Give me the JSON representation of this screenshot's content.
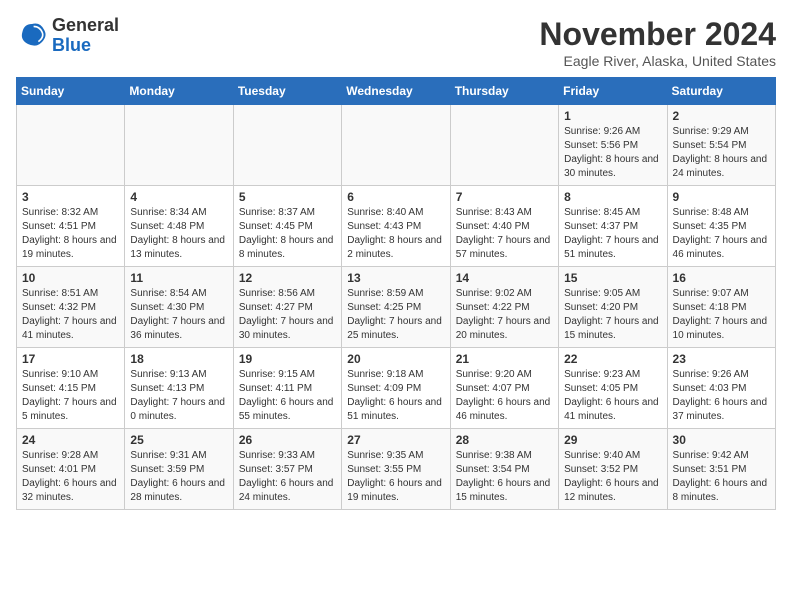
{
  "header": {
    "logo_general": "General",
    "logo_blue": "Blue",
    "month_title": "November 2024",
    "location": "Eagle River, Alaska, United States"
  },
  "days_of_week": [
    "Sunday",
    "Monday",
    "Tuesday",
    "Wednesday",
    "Thursday",
    "Friday",
    "Saturday"
  ],
  "weeks": [
    [
      {
        "day": "",
        "info": ""
      },
      {
        "day": "",
        "info": ""
      },
      {
        "day": "",
        "info": ""
      },
      {
        "day": "",
        "info": ""
      },
      {
        "day": "",
        "info": ""
      },
      {
        "day": "1",
        "info": "Sunrise: 9:26 AM\nSunset: 5:56 PM\nDaylight: 8 hours and 30 minutes."
      },
      {
        "day": "2",
        "info": "Sunrise: 9:29 AM\nSunset: 5:54 PM\nDaylight: 8 hours and 24 minutes."
      }
    ],
    [
      {
        "day": "3",
        "info": "Sunrise: 8:32 AM\nSunset: 4:51 PM\nDaylight: 8 hours and 19 minutes."
      },
      {
        "day": "4",
        "info": "Sunrise: 8:34 AM\nSunset: 4:48 PM\nDaylight: 8 hours and 13 minutes."
      },
      {
        "day": "5",
        "info": "Sunrise: 8:37 AM\nSunset: 4:45 PM\nDaylight: 8 hours and 8 minutes."
      },
      {
        "day": "6",
        "info": "Sunrise: 8:40 AM\nSunset: 4:43 PM\nDaylight: 8 hours and 2 minutes."
      },
      {
        "day": "7",
        "info": "Sunrise: 8:43 AM\nSunset: 4:40 PM\nDaylight: 7 hours and 57 minutes."
      },
      {
        "day": "8",
        "info": "Sunrise: 8:45 AM\nSunset: 4:37 PM\nDaylight: 7 hours and 51 minutes."
      },
      {
        "day": "9",
        "info": "Sunrise: 8:48 AM\nSunset: 4:35 PM\nDaylight: 7 hours and 46 minutes."
      }
    ],
    [
      {
        "day": "10",
        "info": "Sunrise: 8:51 AM\nSunset: 4:32 PM\nDaylight: 7 hours and 41 minutes."
      },
      {
        "day": "11",
        "info": "Sunrise: 8:54 AM\nSunset: 4:30 PM\nDaylight: 7 hours and 36 minutes."
      },
      {
        "day": "12",
        "info": "Sunrise: 8:56 AM\nSunset: 4:27 PM\nDaylight: 7 hours and 30 minutes."
      },
      {
        "day": "13",
        "info": "Sunrise: 8:59 AM\nSunset: 4:25 PM\nDaylight: 7 hours and 25 minutes."
      },
      {
        "day": "14",
        "info": "Sunrise: 9:02 AM\nSunset: 4:22 PM\nDaylight: 7 hours and 20 minutes."
      },
      {
        "day": "15",
        "info": "Sunrise: 9:05 AM\nSunset: 4:20 PM\nDaylight: 7 hours and 15 minutes."
      },
      {
        "day": "16",
        "info": "Sunrise: 9:07 AM\nSunset: 4:18 PM\nDaylight: 7 hours and 10 minutes."
      }
    ],
    [
      {
        "day": "17",
        "info": "Sunrise: 9:10 AM\nSunset: 4:15 PM\nDaylight: 7 hours and 5 minutes."
      },
      {
        "day": "18",
        "info": "Sunrise: 9:13 AM\nSunset: 4:13 PM\nDaylight: 7 hours and 0 minutes."
      },
      {
        "day": "19",
        "info": "Sunrise: 9:15 AM\nSunset: 4:11 PM\nDaylight: 6 hours and 55 minutes."
      },
      {
        "day": "20",
        "info": "Sunrise: 9:18 AM\nSunset: 4:09 PM\nDaylight: 6 hours and 51 minutes."
      },
      {
        "day": "21",
        "info": "Sunrise: 9:20 AM\nSunset: 4:07 PM\nDaylight: 6 hours and 46 minutes."
      },
      {
        "day": "22",
        "info": "Sunrise: 9:23 AM\nSunset: 4:05 PM\nDaylight: 6 hours and 41 minutes."
      },
      {
        "day": "23",
        "info": "Sunrise: 9:26 AM\nSunset: 4:03 PM\nDaylight: 6 hours and 37 minutes."
      }
    ],
    [
      {
        "day": "24",
        "info": "Sunrise: 9:28 AM\nSunset: 4:01 PM\nDaylight: 6 hours and 32 minutes."
      },
      {
        "day": "25",
        "info": "Sunrise: 9:31 AM\nSunset: 3:59 PM\nDaylight: 6 hours and 28 minutes."
      },
      {
        "day": "26",
        "info": "Sunrise: 9:33 AM\nSunset: 3:57 PM\nDaylight: 6 hours and 24 minutes."
      },
      {
        "day": "27",
        "info": "Sunrise: 9:35 AM\nSunset: 3:55 PM\nDaylight: 6 hours and 19 minutes."
      },
      {
        "day": "28",
        "info": "Sunrise: 9:38 AM\nSunset: 3:54 PM\nDaylight: 6 hours and 15 minutes."
      },
      {
        "day": "29",
        "info": "Sunrise: 9:40 AM\nSunset: 3:52 PM\nDaylight: 6 hours and 12 minutes."
      },
      {
        "day": "30",
        "info": "Sunrise: 9:42 AM\nSunset: 3:51 PM\nDaylight: 6 hours and 8 minutes."
      }
    ]
  ]
}
